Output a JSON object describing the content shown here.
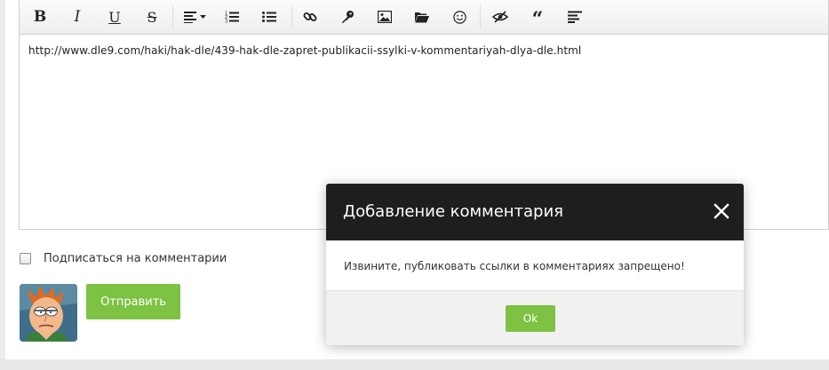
{
  "editor": {
    "content": "http://www.dle9.com/haki/hak-dle/439-hak-dle-zapret-publikacii-ssylki-v-kommentariyah-dlya-dle.html",
    "toolbar": {
      "bold": "B",
      "italic": "I",
      "underline": "U",
      "strike": "S",
      "quote": "“"
    }
  },
  "form": {
    "subscribe_label": "Подписаться на комментарии",
    "send_label": "Отправить"
  },
  "dialog": {
    "title": "Добавление комментария",
    "message": "Извините, публиковать ссылки в комментариях запрещено!",
    "ok_label": "Ok"
  },
  "colors": {
    "accent_green": "#7dc242",
    "dialog_header": "#1e1e1e"
  },
  "icons": [
    "bold-icon",
    "italic-icon",
    "underline-icon",
    "strikethrough-icon",
    "align-icon",
    "ordered-list-icon",
    "unordered-list-icon",
    "link-icon",
    "key-icon",
    "image-icon",
    "folder-icon",
    "smiley-icon",
    "hide-icon",
    "quote-icon",
    "spoiler-icon",
    "close-icon"
  ]
}
